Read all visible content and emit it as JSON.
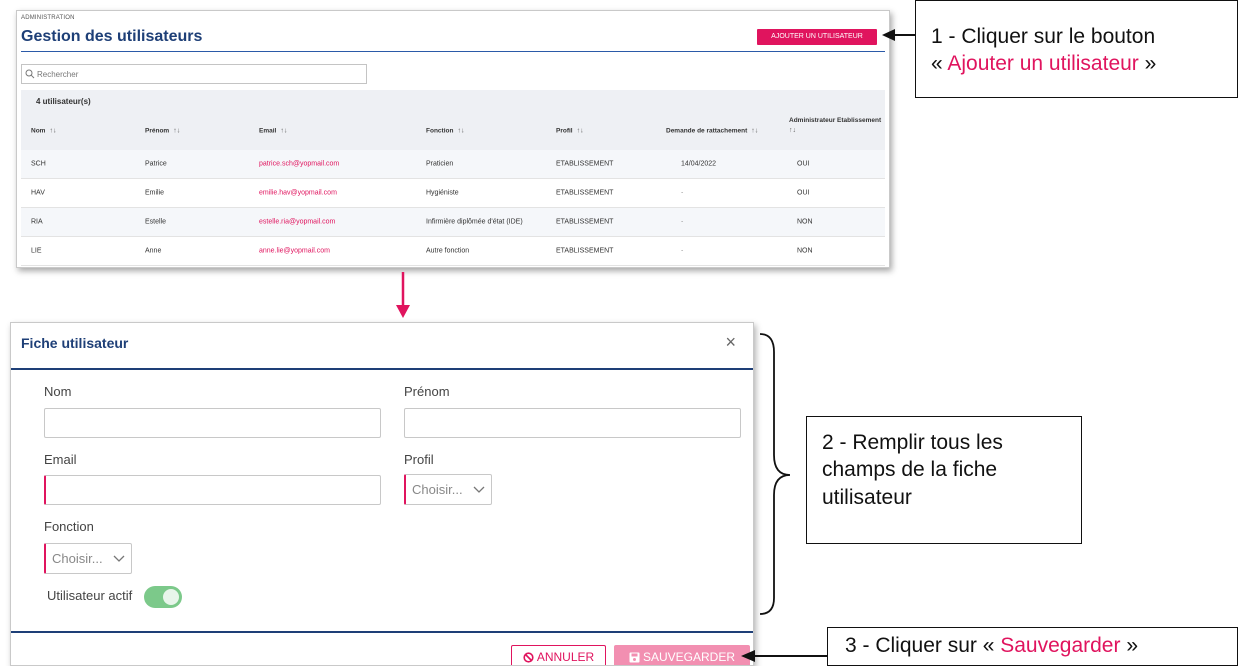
{
  "list_page": {
    "breadcrumb": "ADMINISTRATION",
    "title": "Gestion des utilisateurs",
    "add_button": "AJOUTER UN UTILISATEUR",
    "search_placeholder": "Rechercher",
    "count": "4 utilisateur(s)",
    "sort_glyph": "↑↓",
    "columns": [
      "Nom",
      "Prénom",
      "Email",
      "Fonction",
      "Profil",
      "Demande de rattachement",
      "Administrateur Etablissement"
    ],
    "rows": [
      [
        "SCH",
        "Patrice",
        "patrice.sch@yopmail.com",
        "Praticien",
        "ETABLISSEMENT",
        "14/04/2022",
        "OUI"
      ],
      [
        "HAV",
        "Emilie",
        "emilie.hav@yopmail.com",
        "Hygiéniste",
        "ETABLISSEMENT",
        "-",
        "OUI"
      ],
      [
        "RIA",
        "Estelle",
        "estelle.ria@yopmail.com",
        "Infirmière diplômée d'état (IDE)",
        "ETABLISSEMENT",
        "-",
        "NON"
      ],
      [
        "LIE",
        "Anne",
        "anne.lie@yopmail.com",
        "Autre fonction",
        "ETABLISSEMENT",
        "-",
        "NON"
      ]
    ]
  },
  "modal": {
    "title": "Fiche utilisateur",
    "close": "×",
    "labels": {
      "nom": "Nom",
      "prenom": "Prénom",
      "email": "Email",
      "profil": "Profil",
      "fonction": "Fonction",
      "actif": "Utilisateur actif"
    },
    "nom_value": "",
    "prenom_value": "",
    "email_value": "",
    "profil_selected": "Choisir...",
    "fonction_selected": "Choisir...",
    "actif_on": true,
    "cancel_button": "ANNULER",
    "save_button": "SAUVEGARDER"
  },
  "callouts": {
    "step1_prefix": "1 - Cliquer sur le bouton",
    "step1_open": "« ",
    "step1_highlight": "Ajouter un utilisateur",
    "step1_close": " »",
    "step2_text": "2 - Remplir tous les champs de la fiche utilisateur",
    "step3_prefix": "3 - Cliquer sur « ",
    "step3_highlight": "Sauvegarder",
    "step3_close": " »"
  },
  "colors": {
    "accent": "#e0145e",
    "title_blue": "#1e3f77",
    "toggle_on": "#7cc98a"
  }
}
